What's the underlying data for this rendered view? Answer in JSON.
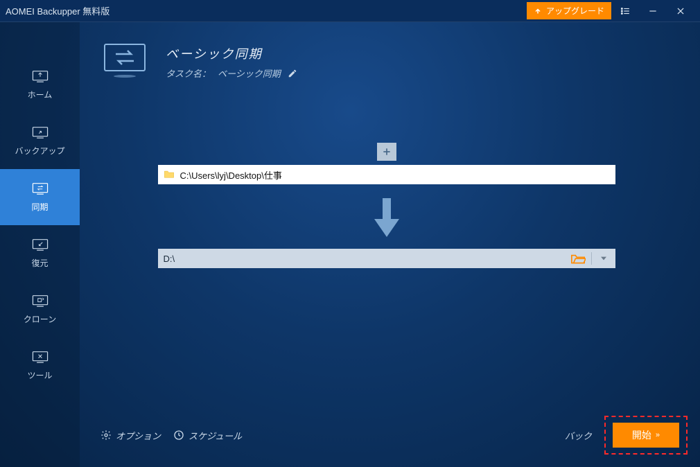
{
  "titlebar": {
    "app_title": "AOMEI Backupper 無料版",
    "upgrade_label": "アップグレード"
  },
  "sidebar": {
    "items": [
      {
        "label": "ホーム"
      },
      {
        "label": "バックアップ"
      },
      {
        "label": "同期"
      },
      {
        "label": "復元"
      },
      {
        "label": "クローン"
      },
      {
        "label": "ツール"
      }
    ]
  },
  "header": {
    "page_title": "ベーシック同期",
    "taskname_label": "タスク名：",
    "taskname_value": "ベーシック同期"
  },
  "sync": {
    "source_path": "C:\\Users\\lyj\\Desktop\\仕事",
    "dest_path": "D:\\"
  },
  "footer": {
    "options_label": "オプション",
    "schedule_label": "スケジュール",
    "back_label": "バック",
    "start_label": "開始"
  },
  "colors": {
    "accent": "#ff8a00",
    "highlight": "#ff2a2a"
  }
}
